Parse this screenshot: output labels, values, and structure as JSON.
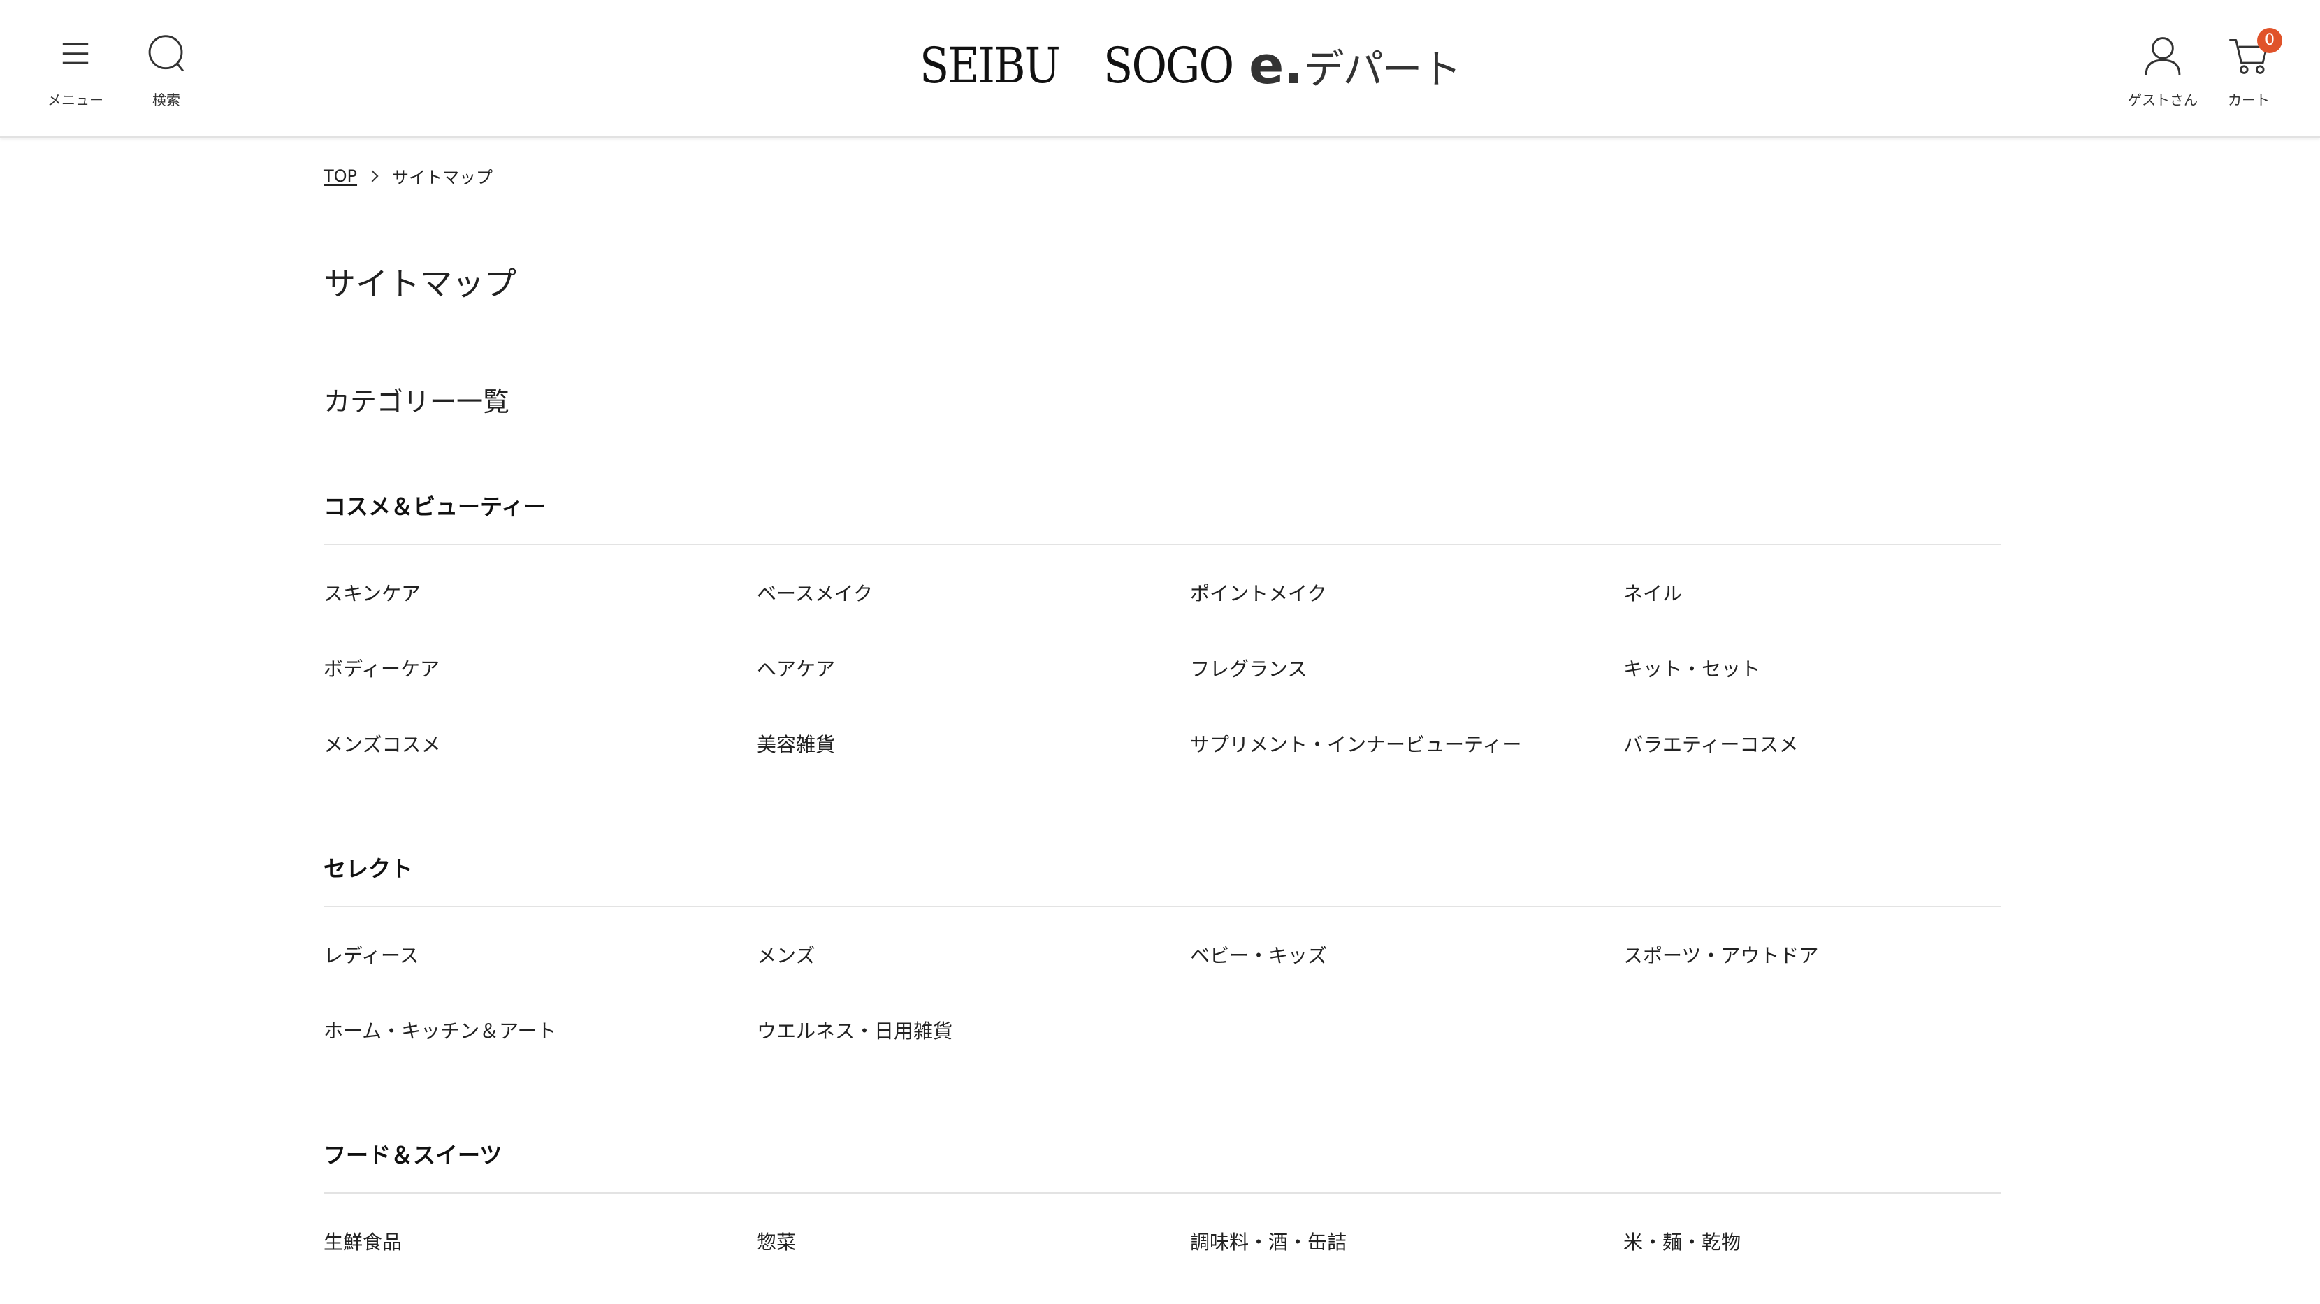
{
  "header": {
    "menu_label": "メニュー",
    "search_label": "検索",
    "guest_label": "ゲストさん",
    "cart_label": "カート",
    "cart_count": "0",
    "logo": {
      "seibu": "SEIBU",
      "sogo": "SOGO",
      "e": "e.",
      "depart": "デパート"
    }
  },
  "breadcrumb": {
    "top": "TOP",
    "current": "サイトマップ"
  },
  "page_title": "サイトマップ",
  "section_title": "カテゴリー一覧",
  "groups": [
    {
      "title": "コスメ＆ビューティー",
      "items": [
        "スキンケア",
        "ベースメイク",
        "ポイントメイク",
        "ネイル",
        "ボディーケア",
        "ヘアケア",
        "フレグランス",
        "キット・セット",
        "メンズコスメ",
        "美容雑貨",
        "サプリメント・インナービューティー",
        "バラエティーコスメ"
      ]
    },
    {
      "title": "セレクト",
      "items": [
        "レディース",
        "メンズ",
        "ベビー・キッズ",
        "スポーツ・アウトドア",
        "ホーム・キッチン＆アート",
        "ウエルネス・日用雑貨"
      ]
    },
    {
      "title": "フード＆スイーツ",
      "items": [
        "生鮮食品",
        "惣菜",
        "調味料・酒・缶詰",
        "米・麺・乾物"
      ]
    }
  ],
  "colors": {
    "badge": "#e0532a",
    "divider": "#e3e3e3",
    "text": "#222222"
  }
}
